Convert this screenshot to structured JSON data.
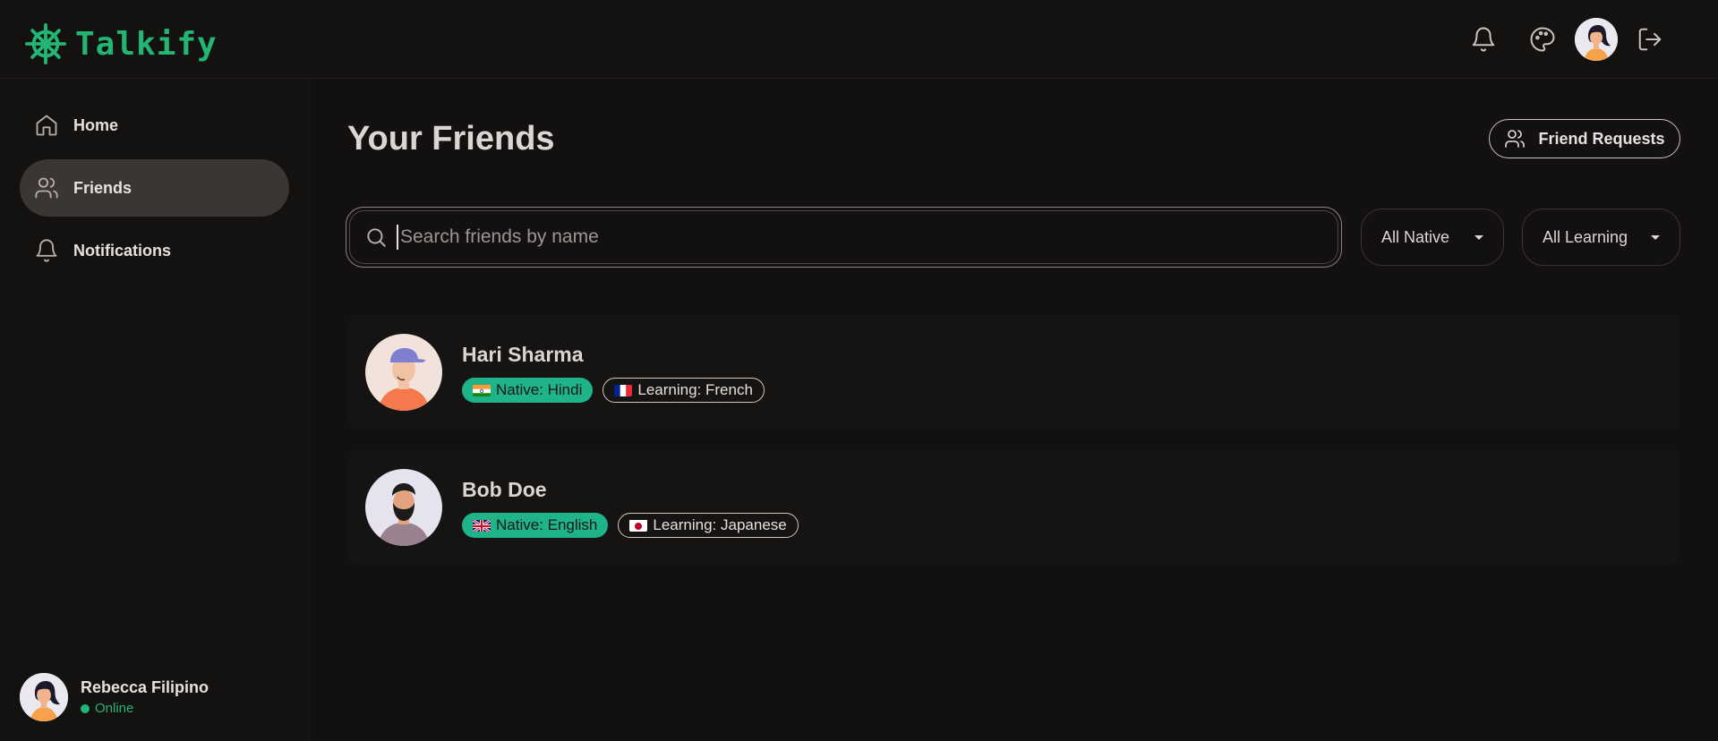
{
  "app": {
    "name": "Talkify",
    "brand_color": "#22b573"
  },
  "header": {
    "icons": [
      "bell-icon",
      "palette-icon",
      "logout-icon"
    ]
  },
  "sidebar": {
    "items": [
      {
        "label": "Home",
        "icon": "home-icon",
        "active": false
      },
      {
        "label": "Friends",
        "icon": "users-icon",
        "active": true
      },
      {
        "label": "Notifications",
        "icon": "bell-icon",
        "active": false
      }
    ],
    "user": {
      "name": "Rebecca Filipino",
      "status": "Online"
    }
  },
  "main": {
    "title": "Your Friends",
    "friend_requests_label": "Friend Requests",
    "search": {
      "placeholder": "Search friends by name",
      "value": ""
    },
    "filters": {
      "native": "All Native",
      "learning": "All Learning"
    },
    "friends": [
      {
        "name": "Hari Sharma",
        "native": "Native: Hindi",
        "learning": "Learning: French"
      },
      {
        "name": "Bob Doe",
        "native": "Native: English",
        "learning": "Learning: Japanese"
      }
    ]
  }
}
